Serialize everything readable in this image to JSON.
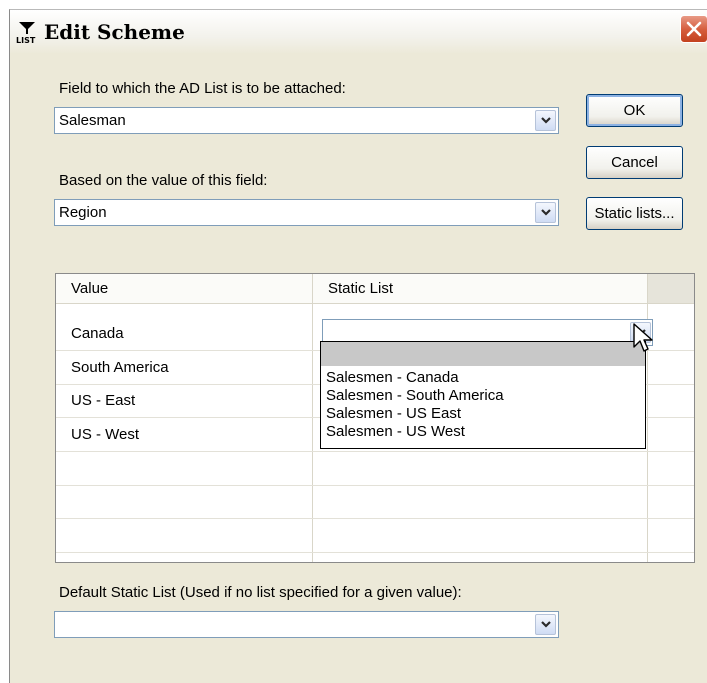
{
  "window": {
    "title": "Edit Scheme",
    "icon": "list-icon",
    "close_icon": "close-icon"
  },
  "form": {
    "field_label": "Field to which the AD List is to be attached:",
    "field_value": "Salesman",
    "based_label": "Based on the value of this field:",
    "based_value": "Region",
    "default_label": "Default Static List (Used if no list specified for a given value):",
    "default_value": ""
  },
  "buttons": {
    "ok": "OK",
    "cancel": "Cancel",
    "static_lists": "Static lists..."
  },
  "grid": {
    "columns": [
      "Value",
      "Static List"
    ],
    "rows": [
      "Canada",
      "South America",
      "US - East",
      "US - West"
    ]
  },
  "dropdown": {
    "options": [
      "Salesmen - Canada",
      "Salesmen - South America",
      "Salesmen - US East",
      "Salesmen - US West"
    ]
  },
  "colors": {
    "accent_border": "#003c74",
    "close_red": "#d55a3a",
    "field_border": "#7f9db9"
  }
}
